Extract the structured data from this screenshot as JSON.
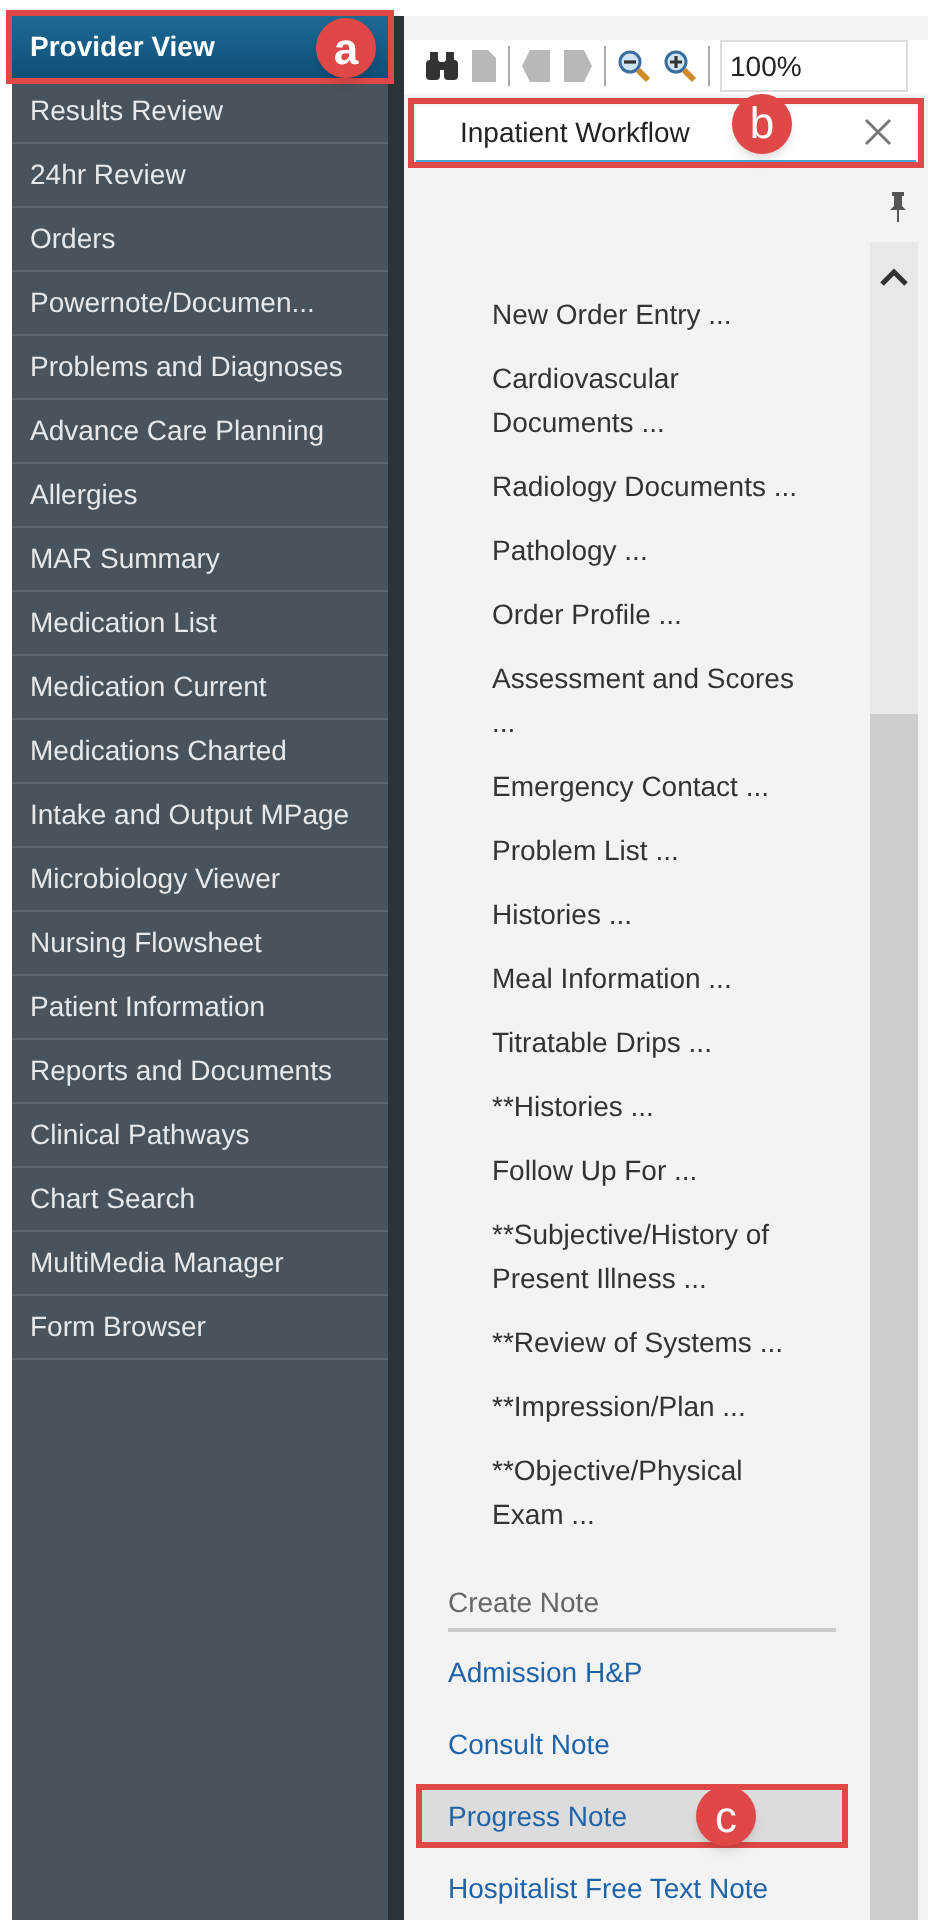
{
  "sidebar": {
    "items": [
      {
        "label": "Provider View",
        "selected": true,
        "callout": "a"
      },
      {
        "label": "Results Review",
        "selected": false
      },
      {
        "label": "24hr Review",
        "selected": false
      },
      {
        "label": "Orders",
        "selected": false
      },
      {
        "label": "Powernote/Documen...",
        "selected": false
      },
      {
        "label": "Problems and Diagnoses",
        "selected": false
      },
      {
        "label": "Advance Care Planning",
        "selected": false
      },
      {
        "label": "Allergies",
        "selected": false
      },
      {
        "label": "MAR Summary",
        "selected": false
      },
      {
        "label": "Medication List",
        "selected": false
      },
      {
        "label": "Medication Current",
        "selected": false
      },
      {
        "label": "Medications Charted",
        "selected": false
      },
      {
        "label": "Intake and Output MPage",
        "selected": false
      },
      {
        "label": "Microbiology Viewer",
        "selected": false
      },
      {
        "label": "Nursing Flowsheet",
        "selected": false
      },
      {
        "label": "Patient Information",
        "selected": false
      },
      {
        "label": "Reports and Documents",
        "selected": false
      },
      {
        "label": "Clinical Pathways",
        "selected": false
      },
      {
        "label": "Chart Search",
        "selected": false
      },
      {
        "label": "MultiMedia Manager",
        "selected": false
      },
      {
        "label": "Form Browser",
        "selected": false
      }
    ]
  },
  "toolbar": {
    "zoom": "100%"
  },
  "tab": {
    "label": "Inpatient Workflow",
    "callout": "b"
  },
  "panel": {
    "items": [
      {
        "kind": "item",
        "label": "New Order Entry ..."
      },
      {
        "kind": "item",
        "label": "Cardiovascular Documents ..."
      },
      {
        "kind": "item",
        "label": "Radiology Documents ..."
      },
      {
        "kind": "item",
        "label": "Pathology ..."
      },
      {
        "kind": "item",
        "label": "Order Profile ..."
      },
      {
        "kind": "item",
        "label": "Assessment and Scores ..."
      },
      {
        "kind": "item",
        "label": "Emergency Contact ..."
      },
      {
        "kind": "item",
        "label": "Problem List ..."
      },
      {
        "kind": "item",
        "label": "Histories ..."
      },
      {
        "kind": "item",
        "label": "Meal Information ..."
      },
      {
        "kind": "item",
        "label": "Titratable Drips ..."
      },
      {
        "kind": "item",
        "label": "**Histories ..."
      },
      {
        "kind": "item",
        "label": "Follow Up For ..."
      },
      {
        "kind": "item",
        "label": "**Subjective/History of Present Illness ..."
      },
      {
        "kind": "item",
        "label": "**Review of Systems ..."
      },
      {
        "kind": "item",
        "label": "**Impression/Plan ..."
      },
      {
        "kind": "item",
        "label": "**Objective/Physical Exam ..."
      },
      {
        "kind": "header",
        "label": "Create Note"
      },
      {
        "kind": "link",
        "label": "Admission H&P",
        "selected": false
      },
      {
        "kind": "link",
        "label": "Consult Note",
        "selected": false
      },
      {
        "kind": "link",
        "label": "Progress Note",
        "selected": true,
        "callout": "c"
      },
      {
        "kind": "link",
        "label": "Hospitalist Free Text Note",
        "selected": false
      }
    ]
  }
}
